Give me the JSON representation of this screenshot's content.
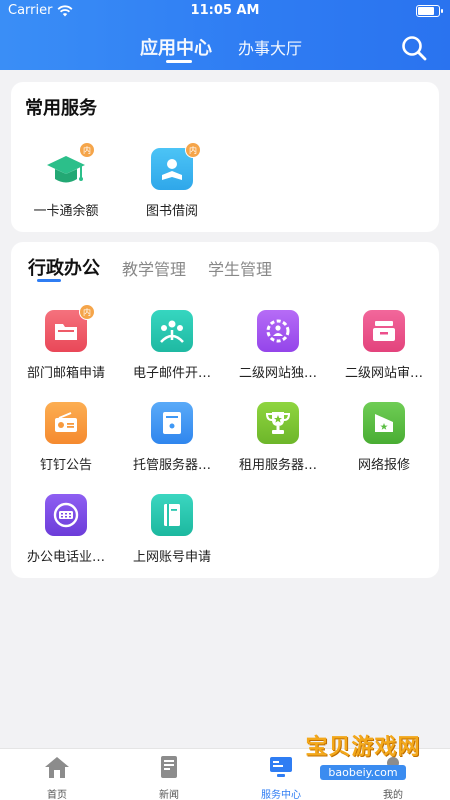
{
  "status_bar": {
    "carrier": "Carrier",
    "time": "11:05 AM",
    "battery_level": 0.85
  },
  "header": {
    "tabs": [
      {
        "label": "应用中心"
      },
      {
        "label": "办事大厅"
      }
    ],
    "search_icon": "search-icon"
  },
  "common_services": {
    "title": "常用服务",
    "items": [
      {
        "label": "一卡通余额",
        "badge": "内",
        "icon": "graduation-cap-icon"
      },
      {
        "label": "图书借阅",
        "badge": "内",
        "icon": "reader-icon"
      }
    ]
  },
  "category_tabs": [
    {
      "label": "行政办公"
    },
    {
      "label": "教学管理"
    },
    {
      "label": "学生管理"
    }
  ],
  "admin_apps": [
    {
      "label": "部门邮箱申请",
      "badge": "内",
      "icon": "folder-icon",
      "color": "#ef5b68"
    },
    {
      "label": "电子邮件开…",
      "icon": "people-icon",
      "color": "#24c7b0"
    },
    {
      "label": "二级网站独…",
      "icon": "gear-people-icon",
      "color": "#a655f0"
    },
    {
      "label": "二级网站审…",
      "icon": "inbox-icon",
      "color": "#ec4f8b"
    },
    {
      "label": "钉钉公告",
      "icon": "radio-icon",
      "color": "#f79a3e"
    },
    {
      "label": "托管服务器…",
      "icon": "server-box-icon",
      "color": "#3f98f5"
    },
    {
      "label": "租用服务器…",
      "icon": "trophy-icon",
      "color": "#7bc631"
    },
    {
      "label": "网络报修",
      "icon": "tent-star-icon",
      "color": "#5bbe43"
    },
    {
      "label": "办公电话业…",
      "icon": "phone-keypad-icon",
      "color": "#7d4de4"
    },
    {
      "label": "上网账号申请",
      "icon": "book-icon",
      "color": "#25c6ad"
    }
  ],
  "tab_bar": {
    "items": [
      {
        "label": "首页",
        "icon": "home-icon"
      },
      {
        "label": "新闻",
        "icon": "news-icon"
      },
      {
        "label": "服务中心",
        "icon": "service-icon"
      },
      {
        "label": "我的",
        "icon": "profile-icon"
      }
    ]
  },
  "watermark": {
    "title": "宝贝游戏网",
    "url": "baobeiy.com"
  },
  "colors": {
    "accent": "#2f7df3",
    "badge": "#f5a54a"
  }
}
